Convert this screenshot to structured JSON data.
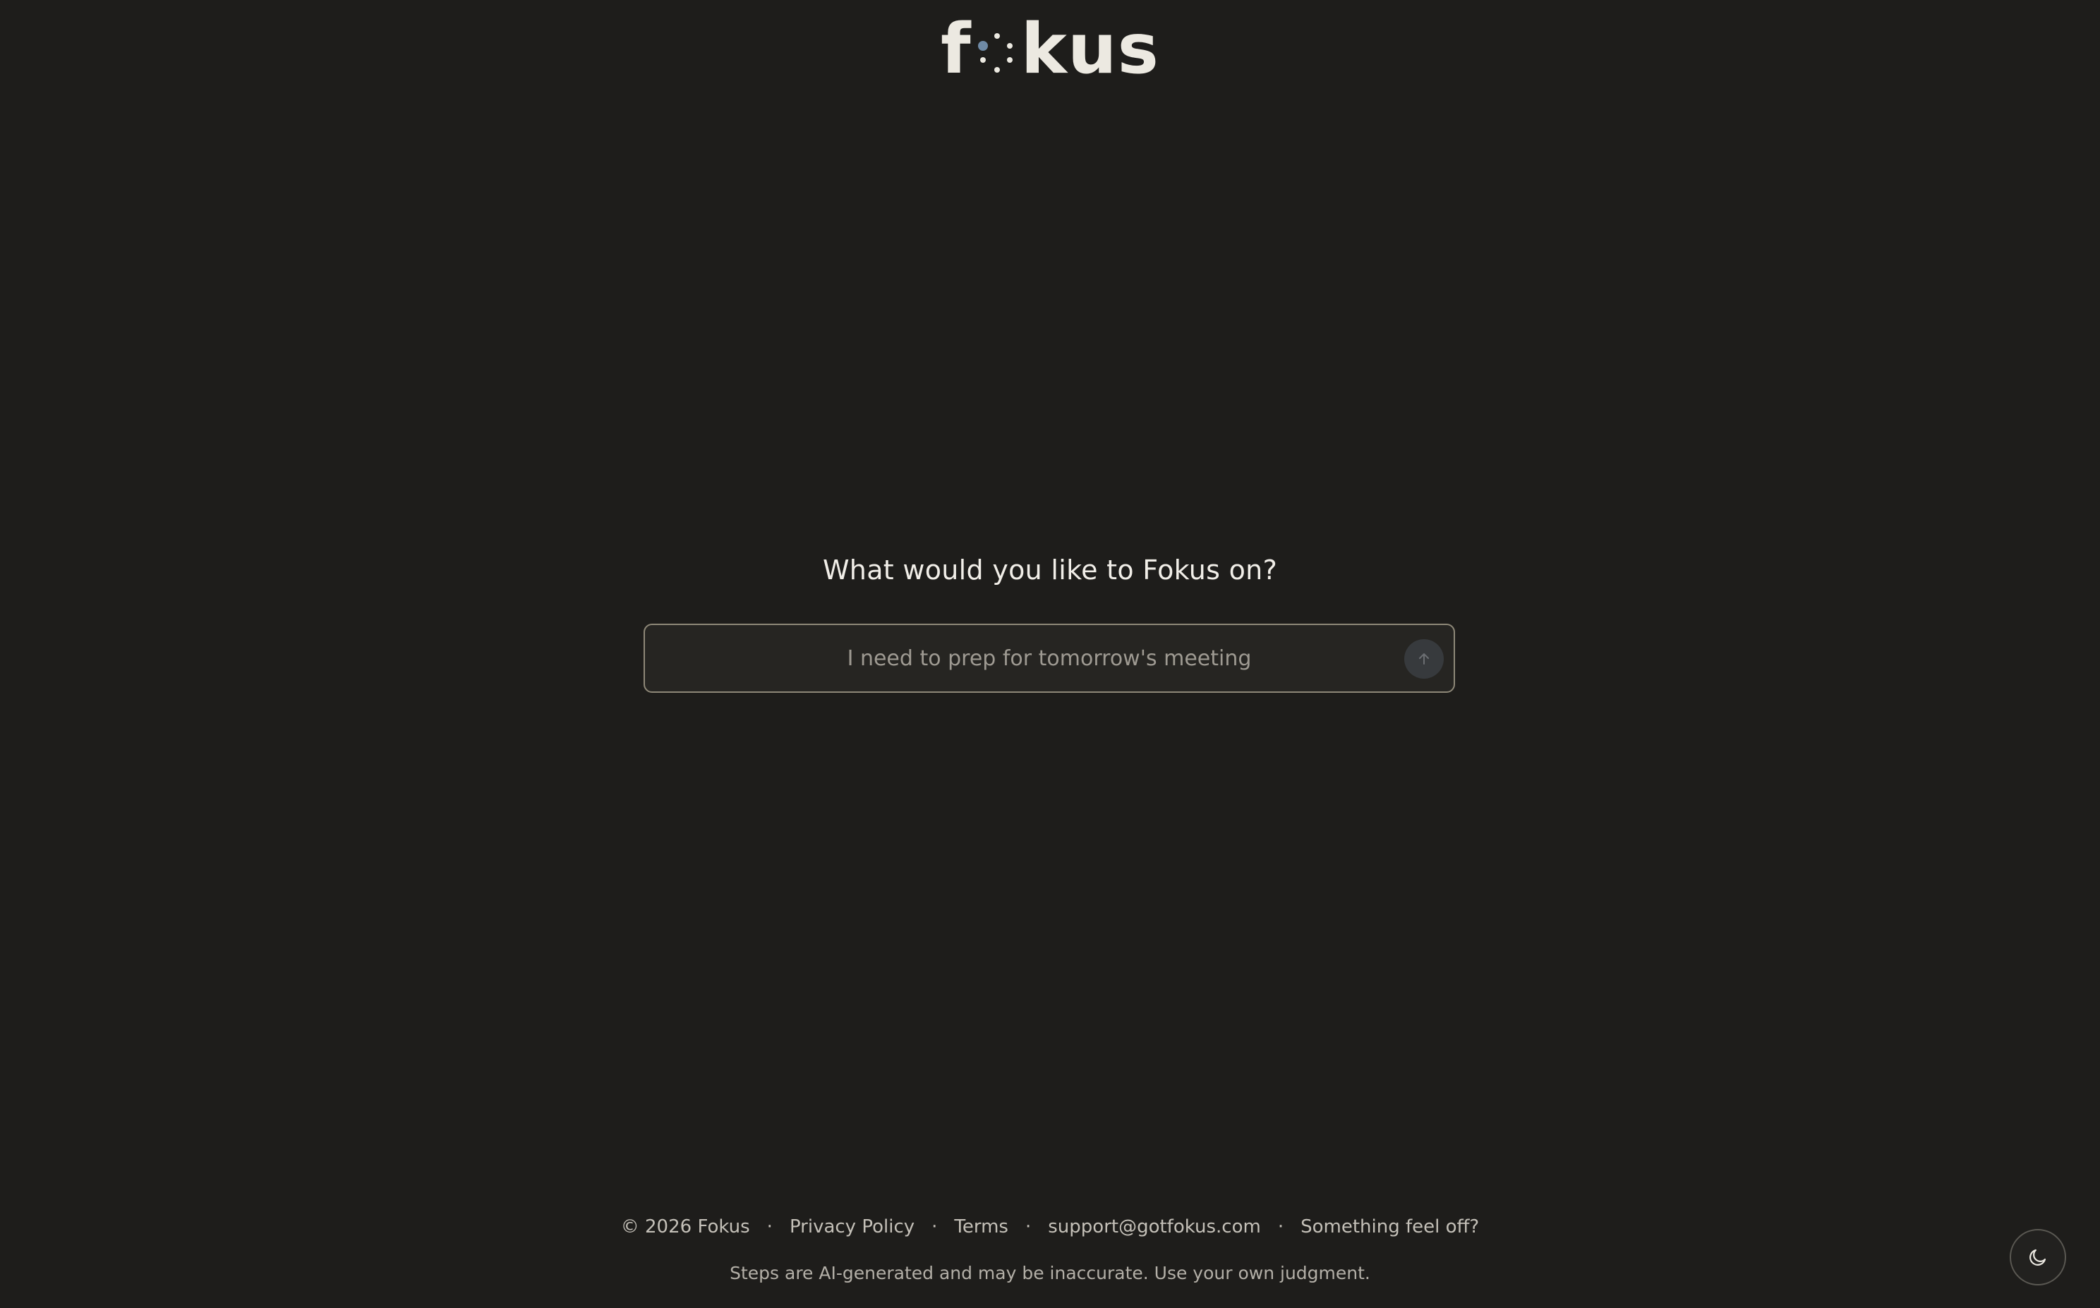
{
  "brand": {
    "logo_prefix": "f",
    "logo_suffix": "kus"
  },
  "main": {
    "heading": "What would you like to Fokus on?",
    "input": {
      "value": "",
      "placeholder": "I need to prep for tomorrow's meeting"
    },
    "submit_icon": "arrow-up-icon"
  },
  "footer": {
    "copyright": "© 2026 Fokus",
    "links": {
      "privacy": "Privacy Policy",
      "terms": "Terms",
      "support_email": "support@gotfokus.com",
      "feedback": "Something feel off?"
    },
    "disclaimer": "Steps are AI-generated and may be inaccurate. Use your own judgment."
  },
  "theme_toggle": {
    "icon": "moon-icon"
  },
  "colors": {
    "background": "#1e1d1b",
    "accent_dot": "#6f8aa6",
    "input_border": "#8e8878",
    "text": "#ebe8e1"
  }
}
